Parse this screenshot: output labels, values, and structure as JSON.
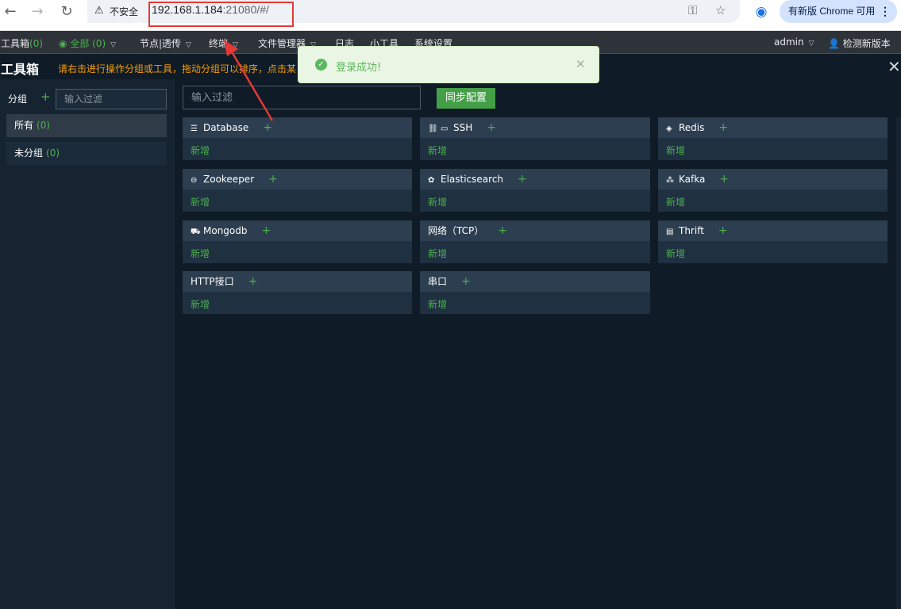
{
  "browser": {
    "security_label": "不安全",
    "url_host": "192.168.1.184",
    "url_rest": ":21080/#/",
    "update_label": "有新版 Chrome 可用"
  },
  "menu": {
    "toolbox": "工具箱",
    "toolbox_count": "(0)",
    "all": "全部 (0)",
    "node": "节点|透传",
    "terminal": "终端",
    "file_manager": "文件管理器",
    "log": "日志",
    "tools": "小工具",
    "settings": "系统设置",
    "user": "admin",
    "check_update": "检测新版本"
  },
  "page": {
    "title": "工具箱",
    "hint": "请右击进行操作分组或工具，拖动分组可以排序，点击某"
  },
  "sidebar": {
    "group_label": "分组",
    "filter_placeholder": "输入过滤",
    "items": [
      {
        "label": "所有",
        "count": "(0)"
      },
      {
        "label": "未分组",
        "count": "(0)"
      }
    ]
  },
  "main": {
    "filter_placeholder": "输入过滤",
    "sync_button": "同步配置",
    "add_label": "新增",
    "cards": [
      {
        "name": "Database",
        "icon": "database-icon"
      },
      {
        "name": "SSH",
        "icon": "ssh-icon"
      },
      {
        "name": "Redis",
        "icon": "redis-icon"
      },
      {
        "name": "Zookeeper",
        "icon": "zookeeper-icon"
      },
      {
        "name": "Elasticsearch",
        "icon": "elasticsearch-icon"
      },
      {
        "name": "Kafka",
        "icon": "kafka-icon"
      },
      {
        "name": "Mongodb",
        "icon": "mongodb-icon"
      },
      {
        "name": "网络（TCP）",
        "icon": ""
      },
      {
        "name": "Thrift",
        "icon": "thrift-icon"
      },
      {
        "name": "HTTP接口",
        "icon": ""
      },
      {
        "name": "串口",
        "icon": ""
      }
    ]
  },
  "toast": {
    "message": "登录成功!"
  },
  "colors": {
    "accent_green": "#4caf50",
    "hint_orange": "#f59e0b",
    "annotation_red": "#e53935"
  }
}
